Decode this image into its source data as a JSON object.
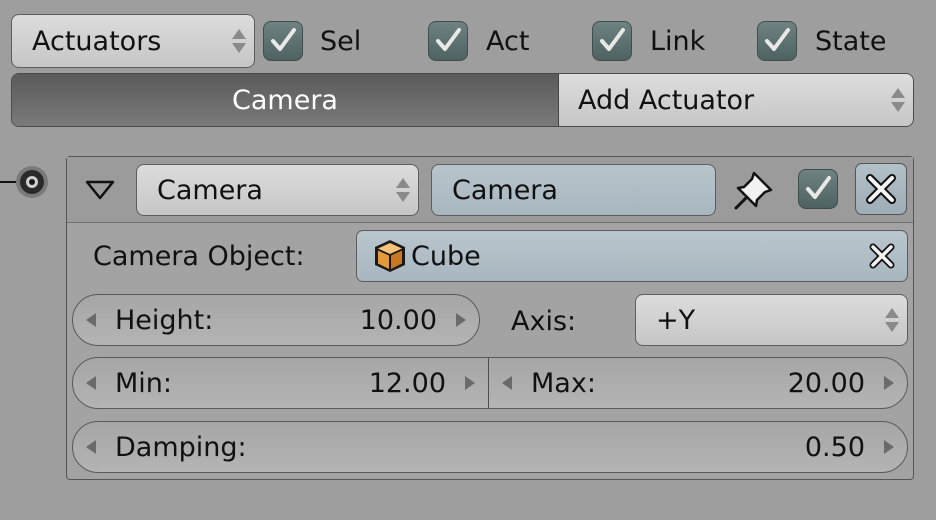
{
  "top_bar": {
    "type_dropdown": "Actuators",
    "checks": [
      {
        "label": "Sel",
        "checked": true
      },
      {
        "label": "Act",
        "checked": true
      },
      {
        "label": "Link",
        "checked": true
      },
      {
        "label": "State",
        "checked": true
      }
    ]
  },
  "header_row": {
    "object_tab": "Camera",
    "add_actuator": "Add Actuator"
  },
  "actuator": {
    "type_dropdown": "Camera",
    "name": "Camera",
    "camera_object_label": "Camera Object:",
    "camera_object_value": "Cube",
    "height_label": "Height:",
    "height_value": "10.00",
    "axis_label": "Axis:",
    "axis_value": "+Y",
    "min_label": "Min:",
    "min_value": "12.00",
    "max_label": "Max:",
    "max_value": "20.00",
    "damping_label": "Damping:",
    "damping_value": "0.50"
  },
  "icons": {
    "pin": "pin-icon",
    "collapse": "triangle-down-icon",
    "remove": "x-icon",
    "object": "cube-icon",
    "clear": "clear-x-icon"
  },
  "colors": {
    "background": "#9e9e9e",
    "active_tab": "#6a6a6a",
    "name_field": "#b0bec6",
    "checkbox": "#5f7272"
  }
}
